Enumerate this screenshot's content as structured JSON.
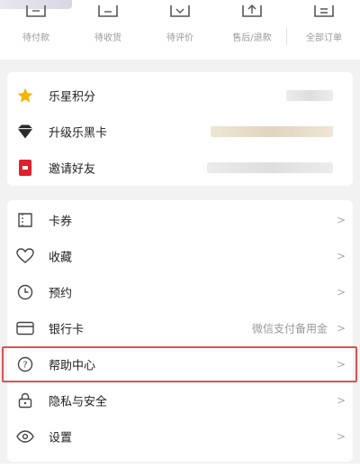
{
  "orders": [
    {
      "label": "待付款",
      "icon": "wallet-icon"
    },
    {
      "label": "待收货",
      "icon": "truck-icon"
    },
    {
      "label": "待评价",
      "icon": "comment-icon"
    },
    {
      "label": "售后/退款",
      "icon": "refund-icon"
    },
    {
      "label": "全部订单",
      "icon": "list-icon"
    }
  ],
  "benefits": [
    {
      "label": "乐星积分",
      "icon": "star-icon",
      "color": "#f5b400"
    },
    {
      "label": "升级乐黑卡",
      "icon": "diamond-icon",
      "color": "#2a2a2a"
    },
    {
      "label": "邀请好友",
      "icon": "gift-icon",
      "color": "#e0202e"
    }
  ],
  "menu": [
    {
      "label": "卡券",
      "icon": "coupon-icon",
      "value": ""
    },
    {
      "label": "收藏",
      "icon": "heart-icon",
      "value": ""
    },
    {
      "label": "预约",
      "icon": "clock-icon",
      "value": ""
    },
    {
      "label": "银行卡",
      "icon": "bank-card-icon",
      "value": "微信支付备用金"
    },
    {
      "label": "帮助中心",
      "icon": "help-icon",
      "value": ""
    },
    {
      "label": "隐私与安全",
      "icon": "lock-icon",
      "value": ""
    },
    {
      "label": "设置",
      "icon": "eye-settings-icon",
      "value": ""
    }
  ],
  "chevron": ">",
  "highlight_color": "#d9534f"
}
